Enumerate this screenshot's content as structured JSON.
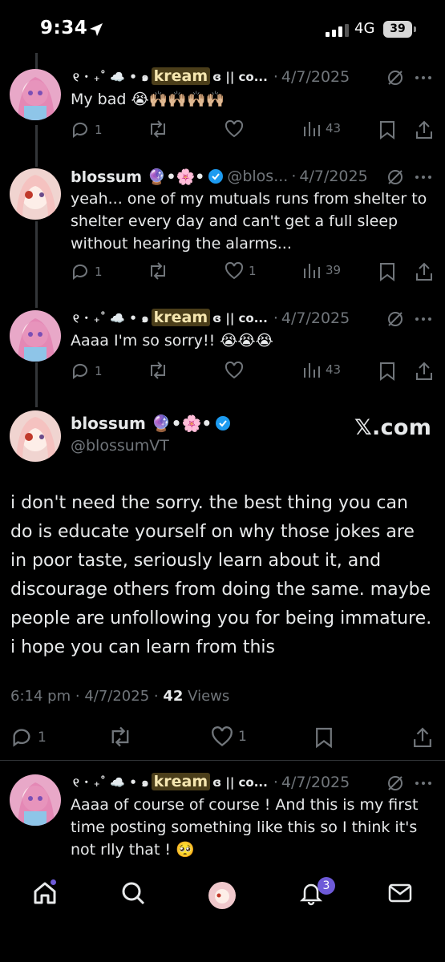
{
  "status_bar": {
    "time": "9:34",
    "network": "4G",
    "battery": "39"
  },
  "replies": [
    {
      "name_prefix": "୧ ･ ₊˚ ☁️ • ๑",
      "name_highlight": "kream",
      "name_suffix": "ɞ || co...",
      "handle": "",
      "separator": "·",
      "date": "4/7/2025",
      "text": "My bad 😭🙌🏼🙌🏼🙌🏼🙌🏼",
      "replies": "1",
      "retweets": "",
      "likes": "",
      "views": "43"
    },
    {
      "name_prefix": "blossum 🔮•🌸•",
      "name_highlight": "",
      "name_suffix": "",
      "handle": "@blos...",
      "separator": "·",
      "date": "4/7/2025",
      "text": "yeah... one of my mutuals runs from shelter to shelter every day and can't get a full sleep without hearing the alarms...",
      "replies": "1",
      "retweets": "",
      "likes": "1",
      "views": "39"
    },
    {
      "name_prefix": "୧ ･ ₊˚ ☁️ • ๑",
      "name_highlight": "kream",
      "name_suffix": "ɞ || co...",
      "handle": "",
      "separator": "·",
      "date": "4/7/2025",
      "text": "Aaaa I'm so sorry!! 😭😭😭",
      "replies": "1",
      "retweets": "",
      "likes": "",
      "views": "43"
    }
  ],
  "main_post": {
    "name": "blossum 🔮•🌸•",
    "handle": "@blossumVT",
    "watermark": "𝕏.com",
    "text": "i don't need the sorry. the best thing you can do is educate yourself on why those jokes are in poor taste, seriously learn about it, and discourage others from doing the same. maybe people are unfollowing you for being immature. i hope you can learn from this",
    "time": "6:14 pm",
    "dot1": "·",
    "date": "4/7/2025",
    "dot2": "·",
    "views_count": "42",
    "views_label": "Views",
    "replies": "1",
    "likes": "1"
  },
  "last_reply": {
    "name_prefix": "୧ ･ ₊˚ ☁️ • ๑",
    "name_highlight": "kream",
    "name_suffix": "ɞ || co...",
    "separator": "·",
    "date": "4/7/2025",
    "text": "Aaaa of course of course ! And this is my first time posting something like this so I think it's not rlly that ! 🥺"
  },
  "tab_bar": {
    "notifications_badge": "3"
  },
  "colors": {
    "accent": "#1d9bf0",
    "badge": "#6e5ad8",
    "muted": "#71767b",
    "text": "#e7e9ea"
  }
}
